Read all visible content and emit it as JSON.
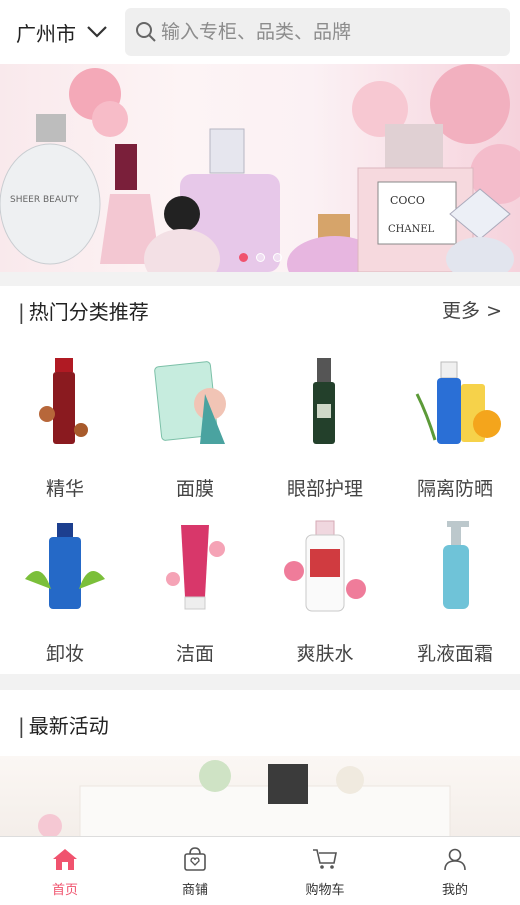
{
  "header": {
    "city": "广州市",
    "search_placeholder": "输入专柜、品类、品牌"
  },
  "banner": {
    "slide_count": 3,
    "active_slide": 1
  },
  "hot_categories": {
    "title": "热门分类推荐",
    "more_label": "更多 >",
    "items": [
      {
        "label": "精华",
        "icon": "essence-bottle-icon"
      },
      {
        "label": "面膜",
        "icon": "face-mask-icon"
      },
      {
        "label": "眼部护理",
        "icon": "eye-care-bottle-icon"
      },
      {
        "label": "隔离防晒",
        "icon": "sunscreen-icon"
      },
      {
        "label": "卸妆",
        "icon": "makeup-remover-icon"
      },
      {
        "label": "洁面",
        "icon": "cleanser-tube-icon"
      },
      {
        "label": "爽肤水",
        "icon": "toner-bottle-icon"
      },
      {
        "label": "乳液面霜",
        "icon": "lotion-pump-icon"
      }
    ]
  },
  "latest_activity": {
    "title": "最新活动"
  },
  "tabbar": {
    "items": [
      {
        "label": "首页",
        "icon": "home-icon",
        "active": true
      },
      {
        "label": "商铺",
        "icon": "shop-bag-icon",
        "active": false
      },
      {
        "label": "购物车",
        "icon": "cart-icon",
        "active": false
      },
      {
        "label": "我的",
        "icon": "user-icon",
        "active": false
      }
    ]
  },
  "colors": {
    "accent": "#f0536e",
    "search_bg": "#efefef",
    "page_bg": "#f2f2f2"
  }
}
